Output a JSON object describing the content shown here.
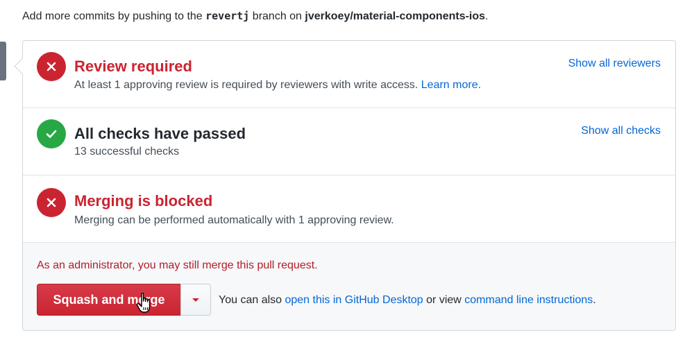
{
  "intro": {
    "prefix": "Add more commits by pushing to the ",
    "branch": "revertj",
    "middle": " branch on ",
    "repo": "jverkoey/material-components-ios",
    "suffix": "."
  },
  "review": {
    "title": "Review required",
    "description": "At least 1 approving review is required by reviewers with write access.",
    "learn_more": "Learn more.",
    "action": "Show all reviewers",
    "status_color": "#cb2431"
  },
  "checks": {
    "title": "All checks have passed",
    "description": "13 successful checks",
    "action": "Show all checks",
    "status_color": "#28a745"
  },
  "blocked": {
    "title": "Merging is blocked",
    "description": "Merging can be performed automatically with 1 approving review.",
    "status_color": "#cb2431"
  },
  "merge": {
    "admin_note": "As an administrator, you may still merge this pull request.",
    "button_label": "Squash and merge",
    "alt_prefix": "You can also ",
    "desktop_link": "open this in GitHub Desktop",
    "alt_middle": " or view ",
    "cli_link": "command line instructions",
    "alt_suffix": "."
  },
  "icons": {
    "fail": "x-icon",
    "pass": "check-icon",
    "dropdown": "caret-down-icon",
    "cursor": "hand-pointer-icon"
  }
}
